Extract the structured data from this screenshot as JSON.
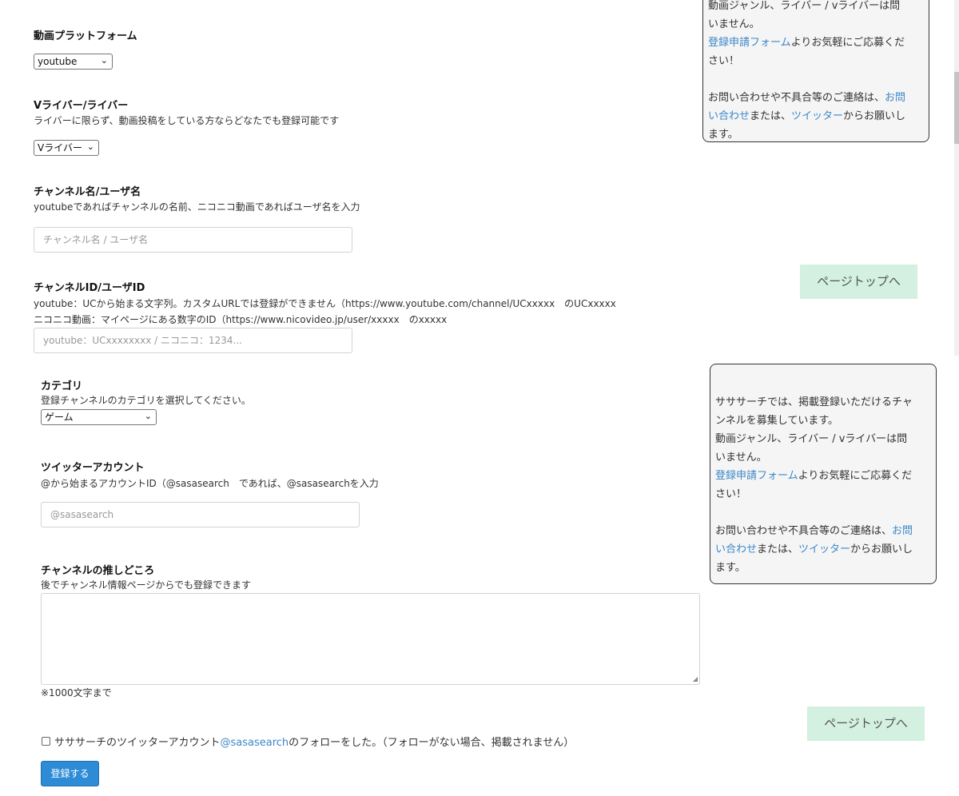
{
  "form": {
    "platform": {
      "label": "動画プラットフォーム",
      "value": "youtube"
    },
    "liver_type": {
      "label": "Vライバー/ライバー",
      "desc": "ライバーに限らず、動画投稿をしている方ならどなたでも登録可能です",
      "value": "Vライバー"
    },
    "channel_name": {
      "label": "チャンネル名/ユーザ名",
      "desc": "youtubeであればチャンネルの名前、ニコニコ動画であればユーザ名を入力",
      "placeholder": "チャンネル名 / ユーザ名"
    },
    "channel_id": {
      "label": "チャンネルID/ユーザID",
      "desc1": "youtube：UCから始まる文字列。カスタムURLでは登録ができません（https://www.youtube.com/channel/UCxxxxx　のUCxxxxx",
      "desc2": "ニコニコ動画：マイページにある数字のID（https://www.nicovideo.jp/user/xxxxx　のxxxxx",
      "placeholder": "youtube：UCxxxxxxxx / ニコニコ：1234..."
    },
    "category": {
      "label": "カテゴリ",
      "desc": "登録チャンネルのカテゴリを選択してください。",
      "value": "ゲーム"
    },
    "twitter": {
      "label": "ツイッターアカウント",
      "desc": "@から始まるアカウントID（@sasasearch　であれば、@sasasearchを入力",
      "placeholder": "@sasasearch"
    },
    "appeal": {
      "label": "チャンネルの推しどころ",
      "desc": "後でチャンネル情報ページからでも登録できます",
      "note": "※1000文字まで"
    },
    "follow": {
      "text_before": "サササーチのツイッターアカウント",
      "link": "@sasasearch",
      "text_after": "のフォローをした。（フォローがない場合、掲載されません）"
    },
    "submit_label": "登録する"
  },
  "info_top": {
    "line_clipped": "動画ジャンル、ライバー / vライバーは問",
    "line2": "いません。",
    "link_form": "登録申請フォーム",
    "text_form_a": "よりお気軽にご応募くだ",
    "text_form_b": "さい！",
    "text_contact_a": "お問い合わせや不具合等のご連絡は、",
    "link_contact_a": "お問",
    "link_contact_b": "い合わせ",
    "text_or": "または、",
    "link_twitter": "ツイッター",
    "text_end_a": "からお願いし",
    "text_end_b": "ます。"
  },
  "info_bottom": {
    "line1": "サササーチでは、掲載登録いただけるチャ",
    "line2": "ンネルを募集しています。",
    "line3": "動画ジャンル、ライバー / vライバーは問",
    "line4": "いません。",
    "link_form": "登録申請フォーム",
    "text_form_a": "よりお気軽にご応募くだ",
    "text_form_b": "さい！",
    "text_contact_a": "お問い合わせや不具合等のご連絡は、",
    "link_contact_a": "お問",
    "link_contact_b": "い合わせ",
    "text_or": "または、",
    "link_twitter": "ツイッター",
    "text_end_a": "からお願いし",
    "text_end_b": "ます。"
  },
  "page_top_label": "ページトップへ",
  "icons": {
    "select_chevron": "chevron-down-icon"
  }
}
